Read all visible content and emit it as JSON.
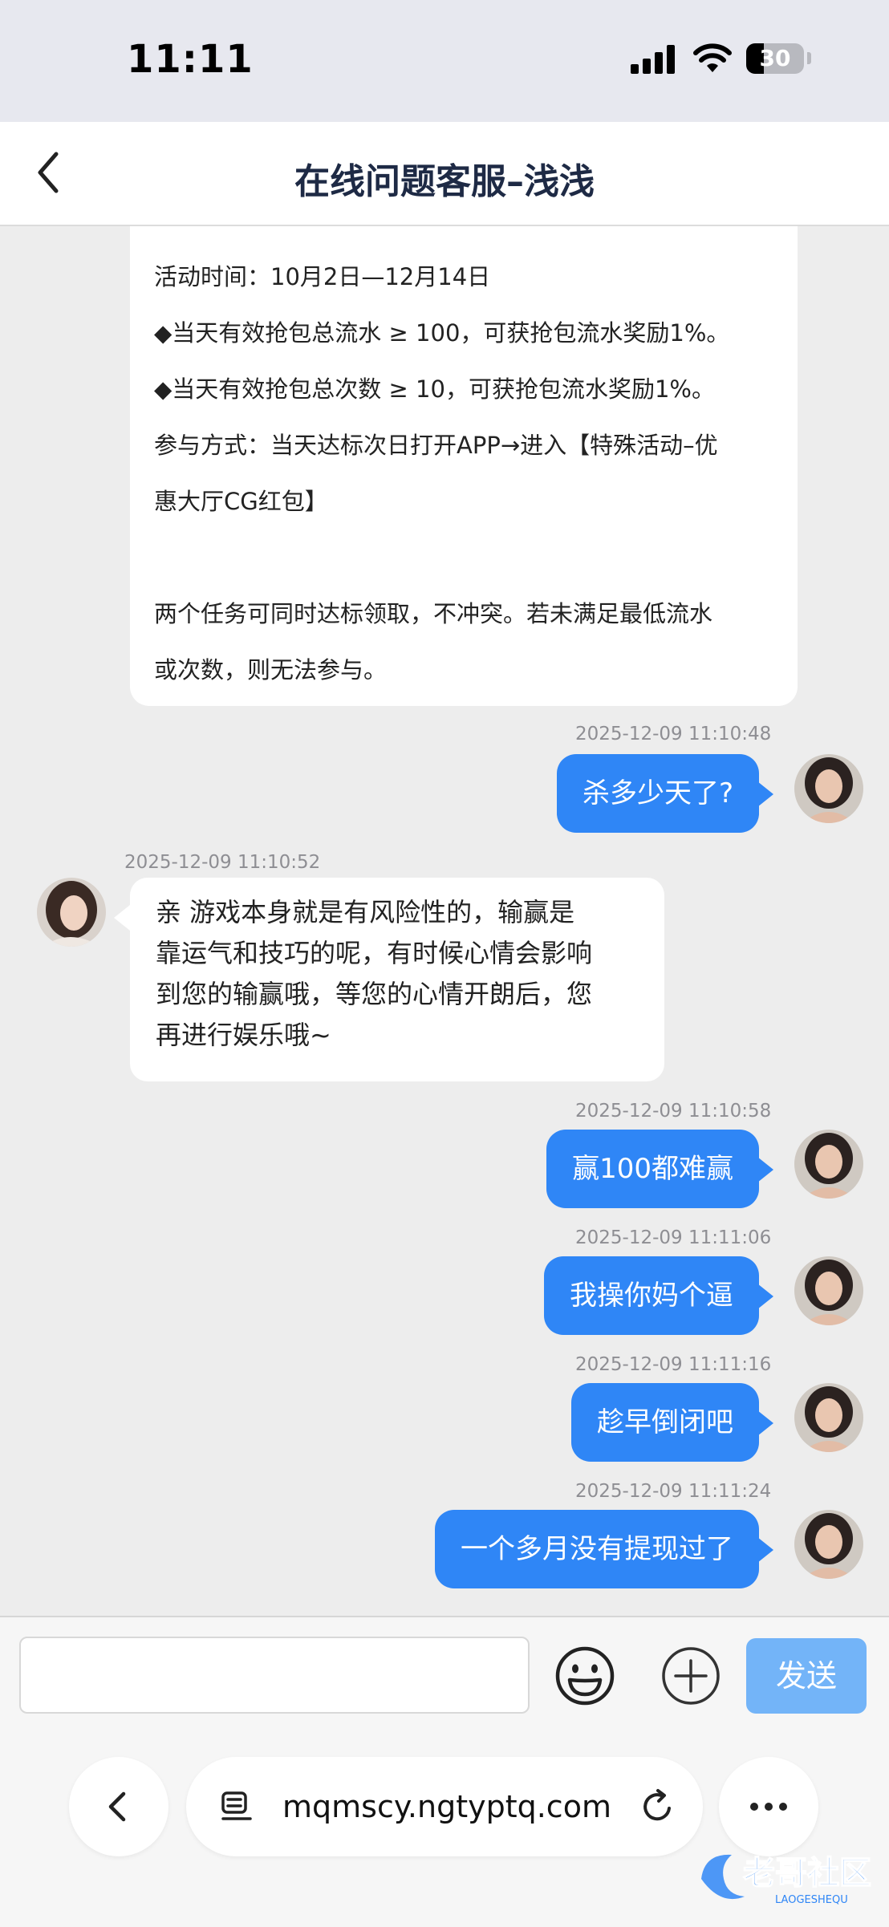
{
  "status_bar": {
    "time": "11:11",
    "battery": "30",
    "battery_level_percent": 30
  },
  "header": {
    "title": "在线问题客服–浅浅"
  },
  "notice": {
    "lines": [
      "活动时间：10月2日—12月14日",
      "◆当天有效抢包总流水 ≥ 100，可获抢包流水奖励1%。",
      "◆当天有效抢包总次数 ≥ 10，可获抢包流水奖励1%。",
      "参与方式：当天达标次日打开APP→进入【特殊活动–优",
      "惠大厅CG红包】",
      "两个任务可同时达标领取，不冲突。若未满足最低流水",
      "或次数，则无法参与。"
    ]
  },
  "messages": [
    {
      "timestamp": "2025-12-09 11:10:48",
      "text": "杀多少天了?"
    },
    {
      "timestamp": "2025-12-09 11:10:52",
      "lines": [
        "亲 游戏本身就是有风险性的，输赢是",
        "靠运气和技巧的呢，有时候心情会影响",
        "到您的输赢哦，等您的心情开朗后，您",
        "再进行娱乐哦~"
      ]
    },
    {
      "timestamp": "2025-12-09 11:10:58",
      "text": "赢100都难赢"
    },
    {
      "timestamp": "2025-12-09 11:11:06",
      "text": "我操你妈个逼"
    },
    {
      "timestamp": "2025-12-09 11:11:16",
      "text": "趁早倒闭吧"
    },
    {
      "timestamp": "2025-12-09 11:11:24",
      "text": "一个多月没有提现过了"
    }
  ],
  "input": {
    "value": "",
    "placeholder": ""
  },
  "send_button": {
    "label": "发送"
  },
  "browser": {
    "url": "mqmscy.ngtyptq.com"
  },
  "watermark": {
    "text": "老哥社区",
    "subtext": "LAOGESHEQU"
  },
  "colors": {
    "accent": "#2f86f6",
    "send_disabled": "#73b4f8",
    "background": "#ededed"
  }
}
